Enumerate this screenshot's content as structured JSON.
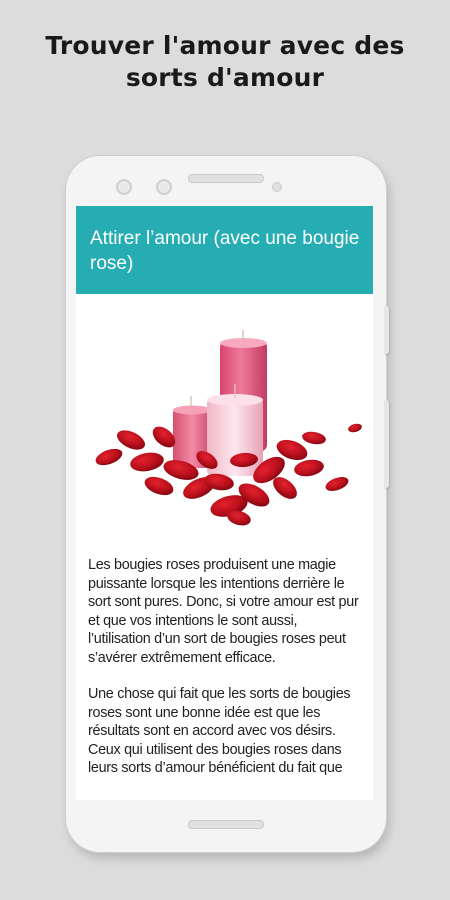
{
  "headline": {
    "line1": "Trouver l'amour avec des",
    "line2": "sorts d'amour"
  },
  "app": {
    "header_title": "Attirer l’amour (avec une bougie rose)",
    "header_color": "#26adb4",
    "image_icon": "pink-candles-rose-petals-image",
    "paragraphs": [
      "Les bougies roses produisent une magie puissante lorsque les intentions derrière le sort sont pures. Donc, si votre amour est pur et que vos intentions le sont aussi, l’utilisation d’un sort de bougies roses peut s’avérer extrêmement efficace.",
      "Une chose qui fait que les sorts de bougies roses sont une bonne idée est que les résultats sont en accord avec vos désirs. Ceux qui utilisent des bougies roses dans leurs sorts d’amour bénéficient du fait que"
    ]
  }
}
